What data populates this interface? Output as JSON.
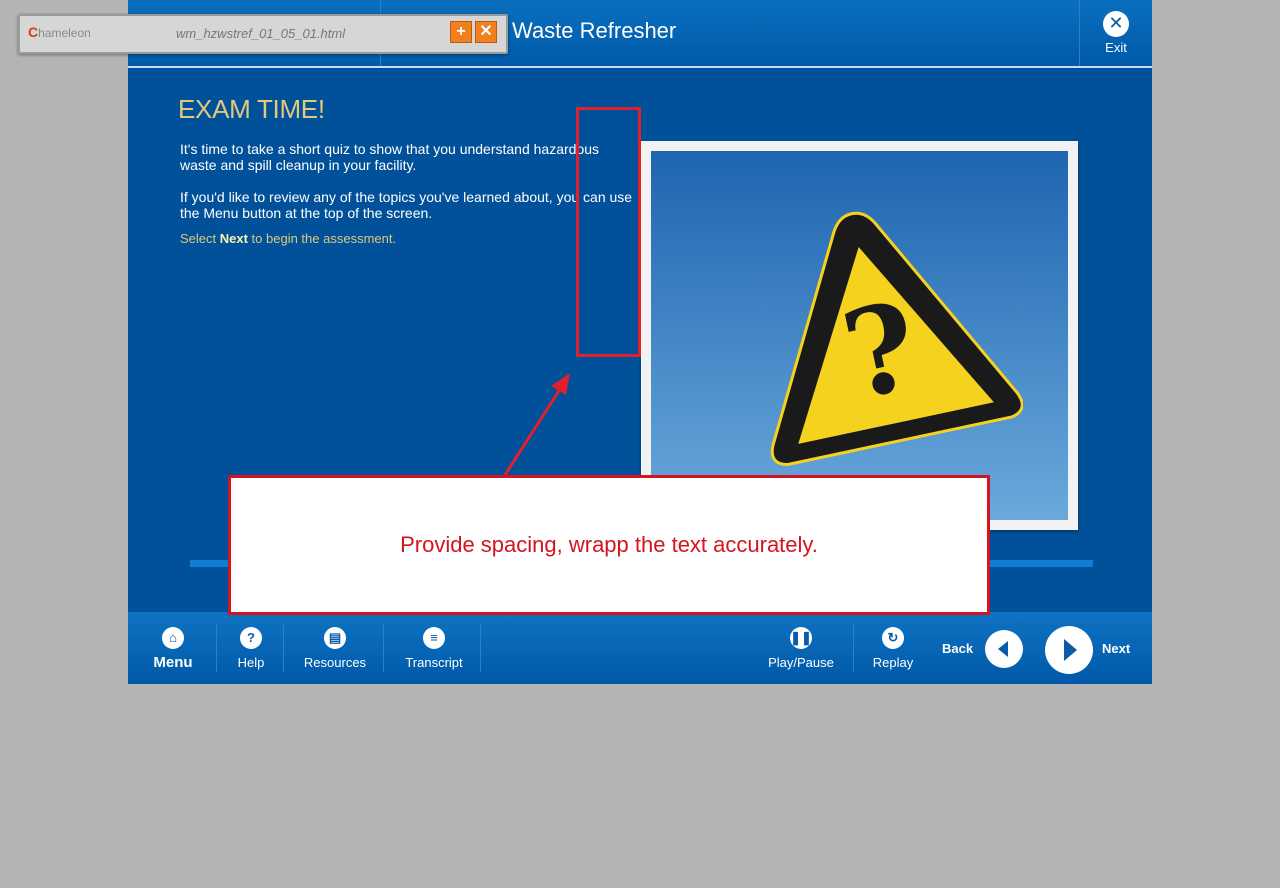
{
  "course": {
    "title": "Waste Refresher"
  },
  "exit": {
    "label": "Exit",
    "icon": "close-icon"
  },
  "content": {
    "heading": "EXAM TIME!",
    "paragraph1": "It's time to take a short quiz to show that you understand hazardous waste and spill cleanup in your facility.",
    "paragraph2": "If you'd like to review any of the topics you've learned about, you can use the Menu button at the top of the screen.",
    "instruction_pre": "Select ",
    "instruction_bold": "Next",
    "instruction_post": " to begin the assessment."
  },
  "toolbar": {
    "menu": "Menu",
    "help": "Help",
    "resources": "Resources",
    "transcript": "Transcript",
    "play_pause": "Play/Pause",
    "replay": "Replay",
    "back": "Back",
    "next": "Next"
  },
  "chameleon": {
    "logo": "hameleon",
    "logo_initial": "C",
    "filename": "wm_hzwstref_01_05_01.html"
  },
  "annotation": {
    "callout_text": "Provide spacing, wrapp the text accurately."
  },
  "colors": {
    "background": "#b4b4b4",
    "course_blue": "#00519a",
    "heading_gold": "#e3c77a",
    "annotation_red": "#d4151f",
    "warning_yellow": "#f5d21e"
  }
}
